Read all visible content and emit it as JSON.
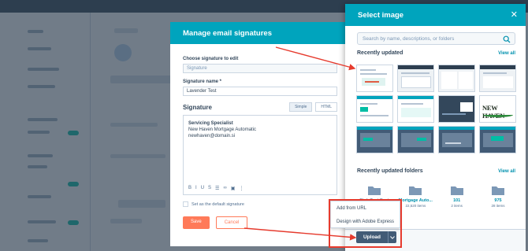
{
  "sig_modal": {
    "title": "Manage email signatures",
    "choose_label": "Choose signature to edit",
    "choose_value": "Signature",
    "name_label": "Signature name *",
    "name_value": "Lavender Test",
    "signature_heading": "Signature",
    "tabs": [
      "Simple",
      "HTML"
    ],
    "body_lines": [
      "Servicing Specialist",
      "New Haven Mortgage Automatic",
      "newhaven@domain.si"
    ],
    "default_label": "Set as the default signature",
    "save": "Save",
    "cancel": "Cancel"
  },
  "panel": {
    "title": "Select image",
    "search_placeholder": "Search by name, descriptions, or folders",
    "recent_title": "Recently updated",
    "view_all": "View all",
    "thumbnail_logo_text": "NEW HAVEN",
    "folders_title": "Recently updated folders",
    "folders": [
      {
        "name": "Pink Test Pact",
        "count": "4 items"
      },
      {
        "name": "Mortgage Auto...",
        "count": "22,520 items"
      },
      {
        "name": "101",
        "count": "2 items"
      },
      {
        "name": "975",
        "count": "28 items"
      }
    ]
  },
  "upload": {
    "menu": [
      "Add from URL",
      "Design with Adobe Express"
    ],
    "button": "Upload"
  },
  "colors": {
    "header_teal": "#00a4bd",
    "link": "#0091ae",
    "annotation_red": "#e63b2e",
    "upload_button": "#425b76"
  }
}
